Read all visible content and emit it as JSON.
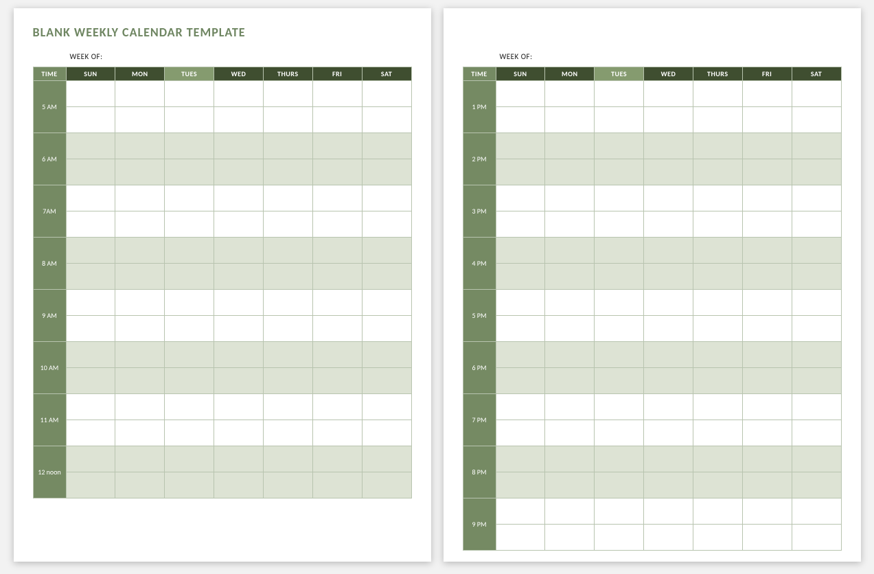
{
  "title": "BLANK WEEKLY CALENDAR TEMPLATE",
  "week_of_label": "WEEK OF:",
  "headers": {
    "time": "TIME",
    "days": [
      "SUN",
      "MON",
      "TUES",
      "WED",
      "THURS",
      "FRI",
      "SAT"
    ]
  },
  "page1_times": [
    "5 AM",
    "6 AM",
    "7AM",
    "8 AM",
    "9 AM",
    "10 AM",
    "11 AM",
    "12 noon"
  ],
  "page2_times": [
    "1 PM",
    "2 PM",
    "3 PM",
    "4 PM",
    "5 PM",
    "6 PM",
    "7 PM",
    "8 PM",
    "9 PM"
  ]
}
